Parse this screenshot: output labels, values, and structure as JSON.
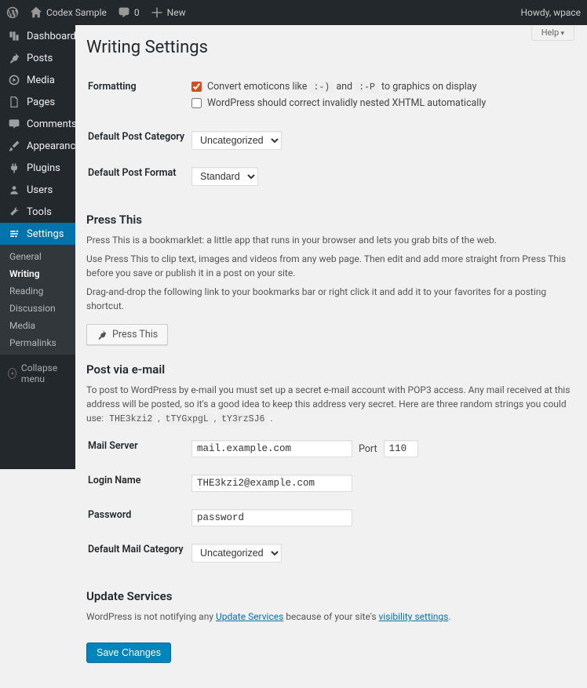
{
  "adminbar": {
    "site_name": "Codex Sample",
    "comments_count": "0",
    "new_label": "New",
    "greeting": "Howdy, wpace",
    "help_label": "Help"
  },
  "sidebar": {
    "items": [
      {
        "key": "dashboard",
        "label": "Dashboard"
      },
      {
        "key": "posts",
        "label": "Posts"
      },
      {
        "key": "media",
        "label": "Media"
      },
      {
        "key": "pages",
        "label": "Pages"
      },
      {
        "key": "comments",
        "label": "Comments"
      },
      {
        "key": "appearance",
        "label": "Appearance"
      },
      {
        "key": "plugins",
        "label": "Plugins"
      },
      {
        "key": "users",
        "label": "Users"
      },
      {
        "key": "tools",
        "label": "Tools"
      },
      {
        "key": "settings",
        "label": "Settings"
      }
    ],
    "settings_sub": [
      {
        "key": "general",
        "label": "General"
      },
      {
        "key": "writing",
        "label": "Writing",
        "current": true
      },
      {
        "key": "reading",
        "label": "Reading"
      },
      {
        "key": "discussion",
        "label": "Discussion"
      },
      {
        "key": "media",
        "label": "Media"
      },
      {
        "key": "permalinks",
        "label": "Permalinks"
      }
    ],
    "collapse_label": "Collapse menu"
  },
  "page": {
    "title": "Writing Settings",
    "formatting_label": "Formatting",
    "emoticons_prefix": "Convert emoticons like ",
    "emoticons_code1": ":-)",
    "emoticons_and": " and ",
    "emoticons_code2": ":-P",
    "emoticons_suffix": " to graphics on display",
    "emoticons_checked": true,
    "xhtml_label": "WordPress should correct invalidly nested XHTML automatically",
    "xhtml_checked": false,
    "default_category_label": "Default Post Category",
    "default_category_value": "Uncategorized",
    "default_format_label": "Default Post Format",
    "default_format_value": "Standard",
    "press_this_heading": "Press This",
    "press_this_p1": "Press This is a bookmarklet: a little app that runs in your browser and lets you grab bits of the web.",
    "press_this_p2": "Use Press This to clip text, images and videos from any web page. Then edit and add more straight from Press This before you save or publish it in a post on your site.",
    "press_this_p3": "Drag-and-drop the following link to your bookmarks bar or right click it and add it to your favorites for a posting shortcut.",
    "press_this_btn": "Press This",
    "post_email_heading": "Post via e-mail",
    "post_email_desc_prefix": "To post to WordPress by e-mail you must set up a secret e-mail account with POP3 access. Any mail received at this address will be posted, so it's a good idea to keep this address very secret. Here are three random strings you could use: ",
    "rand1": "THE3kzi2",
    "rand2": "tTYGxpgL",
    "rand3": "tY3rzSJ6",
    "mail_server_label": "Mail Server",
    "mail_server_value": "mail.example.com",
    "port_label": "Port",
    "port_value": "110",
    "login_name_label": "Login Name",
    "login_name_value": "THE3kzi2@example.com",
    "password_label": "Password",
    "password_value": "password",
    "default_mail_cat_label": "Default Mail Category",
    "default_mail_cat_value": "Uncategorized",
    "update_services_heading": "Update Services",
    "update_services_prefix": "WordPress is not notifying any ",
    "update_services_link1": "Update Services",
    "update_services_mid": " because of your site's ",
    "update_services_link2": "visibility settings",
    "save_button": "Save Changes"
  }
}
